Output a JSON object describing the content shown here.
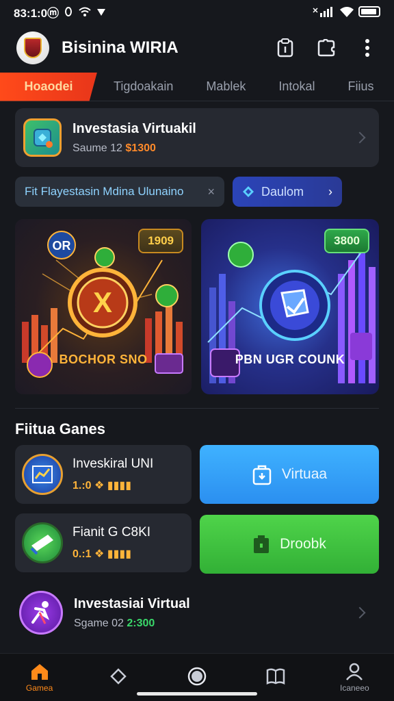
{
  "status": {
    "time": "83:1:0ⓜ",
    "icons": [
      "dnd-icon",
      "alarm-icon",
      "wifi-icon",
      "signal-icon"
    ]
  },
  "app": {
    "title": "Bisinina WIRIA"
  },
  "tabs": [
    {
      "label": "Hoaodei"
    },
    {
      "label": "Tigdoakain"
    },
    {
      "label": "Mablek"
    },
    {
      "label": "Intokal"
    },
    {
      "label": "Fiius"
    }
  ],
  "top_card": {
    "title": "Investasia Virtuakil",
    "subtitle": "Saume 12",
    "value": "$1300"
  },
  "filter_chip": {
    "label": "Fit Flayestasin Mdina Ulunaino",
    "close": "×"
  },
  "filter_button": {
    "label": "Daulom",
    "arrow": "›"
  },
  "banners": [
    {
      "badge": "1909",
      "caption": "BOCHOR SNO",
      "center_glyph": "X",
      "top_label": "OR"
    },
    {
      "badge": "3800",
      "caption": "PBN UGR COUNK"
    }
  ],
  "section": {
    "title": "Fiitua Ganes"
  },
  "games": [
    {
      "title": "Inveskiral UNI",
      "meta": "1.:0 ❖ ▮▮▮▮"
    },
    {
      "title": "Fianit G C8KI",
      "meta": "0.:1 ❖ ▮▮▮▮"
    }
  ],
  "actions": [
    {
      "label": "Virtuaa",
      "color": "#3fb2ff"
    },
    {
      "label": "Droobk",
      "color": "#4fd44a"
    }
  ],
  "list_item": {
    "title": "Investasiai Virtual",
    "subtitle": "Sgame 02",
    "value": "2:300"
  },
  "bottom_nav": [
    {
      "label": "Gamea",
      "icon": "home-icon"
    },
    {
      "label": "",
      "icon": "tag-icon"
    },
    {
      "label": "",
      "icon": "circle-icon"
    },
    {
      "label": "",
      "icon": "book-icon"
    },
    {
      "label": "Icaneeo",
      "icon": "profile-icon"
    }
  ],
  "colors": {
    "accent": "#ff4a1a",
    "background": "#16181d",
    "card": "#262931"
  }
}
